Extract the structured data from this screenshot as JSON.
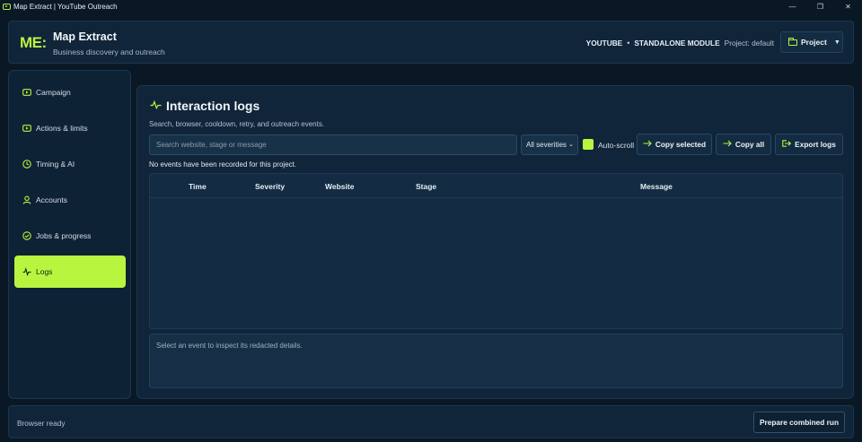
{
  "window": {
    "title": "Map Extract | YouTube Outreach",
    "controls": [
      "—",
      "❐",
      "✕"
    ]
  },
  "header": {
    "logo": "ME:",
    "title": "Map Extract",
    "subtitle": "Business discovery and outreach",
    "platform": "YOUTUBE",
    "separator": "•",
    "module": "STANDALONE MODULE",
    "project_label": "Project: default",
    "project_button": "Project"
  },
  "sidebar": {
    "items": [
      {
        "label": "Campaign",
        "icon": "play-box-icon",
        "active": false
      },
      {
        "label": "Actions & limits",
        "icon": "play-box-icon",
        "active": false
      },
      {
        "label": "Timing & AI",
        "icon": "clock-icon",
        "active": false
      },
      {
        "label": "Accounts",
        "icon": "user-icon",
        "active": false
      },
      {
        "label": "Jobs & progress",
        "icon": "check-circle-icon",
        "active": false
      },
      {
        "label": "Logs",
        "icon": "pulse-icon",
        "active": true
      }
    ]
  },
  "main": {
    "title": "Interaction logs",
    "subtitle": "Search, browser, cooldown, retry, and outreach events.",
    "search_placeholder": "Search website, stage or message",
    "severity_value": "All severities",
    "autoscroll_label": "Auto-scroll",
    "autoscroll_checked": true,
    "buttons": {
      "copy_selected": "Copy selected",
      "copy_all": "Copy all",
      "export_logs": "Export logs"
    },
    "empty_note": "No events have been recorded for this project.",
    "columns": [
      "Time",
      "Severity",
      "Website",
      "Stage",
      "Message"
    ],
    "rows": [],
    "details_placeholder": "Select an event to inspect its redacted details."
  },
  "footer": {
    "status": "Browser ready",
    "combined_button": "Prepare combined run"
  },
  "colors": {
    "accent": "#b8f53f",
    "background": "#0a1826",
    "panel": "#10253a"
  }
}
